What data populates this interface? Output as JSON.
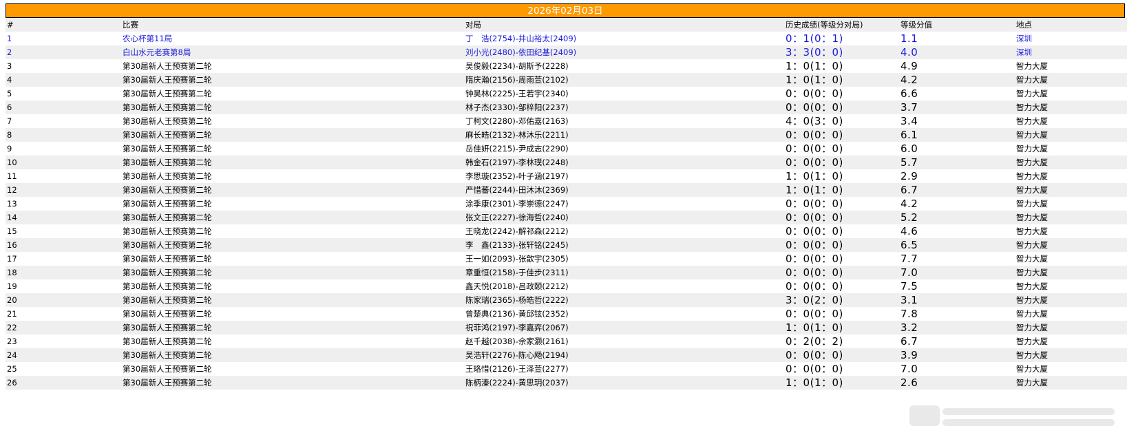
{
  "header": {
    "date": "2026年02月03日"
  },
  "columns": [
    "#",
    "比赛",
    "对局",
    "历史成绩(等级分对局)",
    "等级分值",
    "地点"
  ],
  "rows": [
    {
      "no": "1",
      "event": "农心杯第11局",
      "game": "丁　浩(2754)-井山裕太(2409)",
      "history": "0：1(0：1)",
      "value": "1.1",
      "location": "深圳",
      "link": true
    },
    {
      "no": "2",
      "event": "白山水元老赛第8局",
      "game": "刘小光(2480)-依田纪基(2409)",
      "history": "3：3(0：0)",
      "value": "4.0",
      "location": "深圳",
      "link": true
    },
    {
      "no": "3",
      "event": "第30届新人王预赛第二轮",
      "game": "吴俊毅(2234)-胡斯予(2228)",
      "history": "1：0(1：0)",
      "value": "4.9",
      "location": "智力大厦",
      "link": false
    },
    {
      "no": "4",
      "event": "第30届新人王预赛第二轮",
      "game": "隋庆瀚(2156)-周雨萱(2102)",
      "history": "1：0(1：0)",
      "value": "4.2",
      "location": "智力大厦",
      "link": false
    },
    {
      "no": "5",
      "event": "第30届新人王预赛第二轮",
      "game": "钟昊林(2225)-王若宇(2340)",
      "history": "0：0(0：0)",
      "value": "6.6",
      "location": "智力大厦",
      "link": false
    },
    {
      "no": "6",
      "event": "第30届新人王预赛第二轮",
      "game": "林子杰(2330)-邹梓阳(2237)",
      "history": "0：0(0：0)",
      "value": "3.7",
      "location": "智力大厦",
      "link": false
    },
    {
      "no": "7",
      "event": "第30届新人王预赛第二轮",
      "game": "丁柯文(2280)-邓佑嘉(2163)",
      "history": "4：0(3：0)",
      "value": "3.4",
      "location": "智力大厦",
      "link": false
    },
    {
      "no": "8",
      "event": "第30届新人王预赛第二轮",
      "game": "麻长皓(2132)-林沐乐(2211)",
      "history": "0：0(0：0)",
      "value": "6.1",
      "location": "智力大厦",
      "link": false
    },
    {
      "no": "9",
      "event": "第30届新人王预赛第二轮",
      "game": "岳佳妍(2215)-尹成志(2290)",
      "history": "0：0(0：0)",
      "value": "6.0",
      "location": "智力大厦",
      "link": false
    },
    {
      "no": "10",
      "event": "第30届新人王预赛第二轮",
      "game": "韩金石(2197)-李林璞(2248)",
      "history": "0：0(0：0)",
      "value": "5.7",
      "location": "智力大厦",
      "link": false
    },
    {
      "no": "11",
      "event": "第30届新人王预赛第二轮",
      "game": "李思璇(2352)-叶子涵(2197)",
      "history": "1：0(1：0)",
      "value": "2.9",
      "location": "智力大厦",
      "link": false
    },
    {
      "no": "12",
      "event": "第30届新人王预赛第二轮",
      "game": "严惜蕃(2244)-田沐沐(2369)",
      "history": "1：0(1：0)",
      "value": "6.7",
      "location": "智力大厦",
      "link": false
    },
    {
      "no": "13",
      "event": "第30届新人王预赛第二轮",
      "game": "涂季康(2301)-李崇德(2247)",
      "history": "0：0(0：0)",
      "value": "4.2",
      "location": "智力大厦",
      "link": false
    },
    {
      "no": "14",
      "event": "第30届新人王预赛第二轮",
      "game": "张文正(2227)-徐海哲(2240)",
      "history": "0：0(0：0)",
      "value": "5.2",
      "location": "智力大厦",
      "link": false
    },
    {
      "no": "15",
      "event": "第30届新人王预赛第二轮",
      "game": "王晓龙(2242)-解祁森(2212)",
      "history": "0：0(0：0)",
      "value": "4.6",
      "location": "智力大厦",
      "link": false
    },
    {
      "no": "16",
      "event": "第30届新人王预赛第二轮",
      "game": "李　鑫(2133)-张轩铭(2245)",
      "history": "0：0(0：0)",
      "value": "6.5",
      "location": "智力大厦",
      "link": false
    },
    {
      "no": "17",
      "event": "第30届新人王预赛第二轮",
      "game": "王一如(2093)-张歆宇(2305)",
      "history": "0：0(0：0)",
      "value": "7.7",
      "location": "智力大厦",
      "link": false
    },
    {
      "no": "18",
      "event": "第30届新人王预赛第二轮",
      "game": "章重恒(2158)-于佳步(2311)",
      "history": "0：0(0：0)",
      "value": "7.0",
      "location": "智力大厦",
      "link": false
    },
    {
      "no": "19",
      "event": "第30届新人王预赛第二轮",
      "game": "鑫天悦(2018)-吕政颐(2212)",
      "history": "0：0(0：0)",
      "value": "7.5",
      "location": "智力大厦",
      "link": false
    },
    {
      "no": "20",
      "event": "第30届新人王预赛第二轮",
      "game": "陈家瑞(2365)-杨皓哲(2222)",
      "history": "3：0(2：0)",
      "value": "3.1",
      "location": "智力大厦",
      "link": false
    },
    {
      "no": "21",
      "event": "第30届新人王预赛第二轮",
      "game": "曾楚典(2136)-黄邱铉(2352)",
      "history": "0：0(0：0)",
      "value": "7.8",
      "location": "智力大厦",
      "link": false
    },
    {
      "no": "22",
      "event": "第30届新人王预赛第二轮",
      "game": "祝菲鸿(2197)-李嘉弈(2067)",
      "history": "1：0(1：0)",
      "value": "3.2",
      "location": "智力大厦",
      "link": false
    },
    {
      "no": "23",
      "event": "第30届新人王预赛第二轮",
      "game": "赵千越(2038)-佘家灏(2161)",
      "history": "0：2(0：2)",
      "value": "6.7",
      "location": "智力大厦",
      "link": false
    },
    {
      "no": "24",
      "event": "第30届新人王预赛第二轮",
      "game": "吴浩轩(2276)-陈心飏(2194)",
      "history": "0：0(0：0)",
      "value": "3.9",
      "location": "智力大厦",
      "link": false
    },
    {
      "no": "25",
      "event": "第30届新人王预赛第二轮",
      "game": "王珞惜(2126)-王泽萱(2277)",
      "history": "0：0(0：0)",
      "value": "7.0",
      "location": "智力大厦",
      "link": false
    },
    {
      "no": "26",
      "event": "第30届新人王预赛第二轮",
      "game": "陈柄溱(2224)-黄思玥(2037)",
      "history": "1：0(1：0)",
      "value": "2.6",
      "location": "智力大厦",
      "link": false
    }
  ]
}
